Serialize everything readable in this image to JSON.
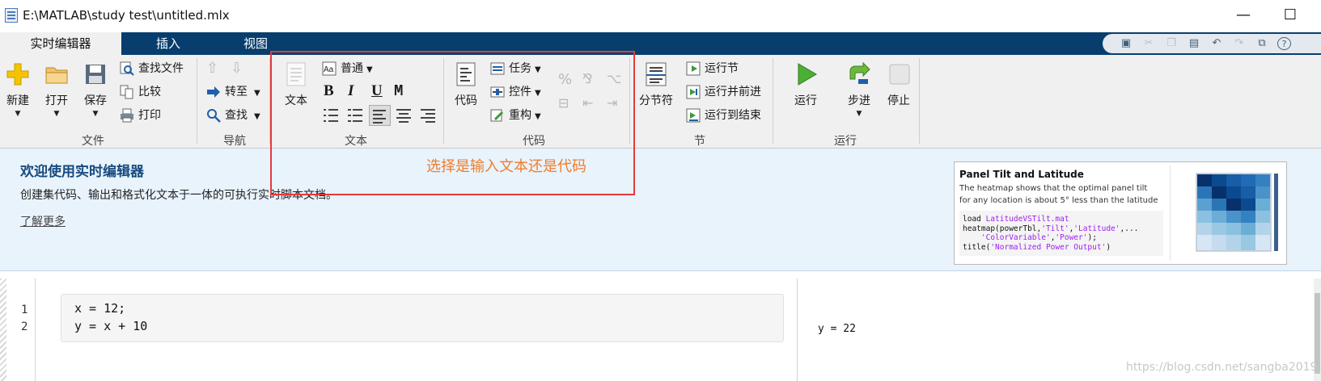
{
  "window": {
    "title": "E:\\MATLAB\\study test\\untitled.mlx",
    "minimize": "—",
    "maximize": "☐"
  },
  "tabs": [
    {
      "label": "实时编辑器",
      "active": true
    },
    {
      "label": "插入",
      "active": false
    },
    {
      "label": "视图",
      "active": false
    }
  ],
  "file_group": {
    "new": "新建",
    "open": "打开",
    "save": "保存",
    "find_files": "查找文件",
    "compare": "比较",
    "print": "打印",
    "label": "文件"
  },
  "nav_group": {
    "goto": "转至",
    "find": "查找",
    "label": "导航"
  },
  "text_group": {
    "text": "文本",
    "style": "普通",
    "bold": "B",
    "italic": "I",
    "underline": "U",
    "mono": "M",
    "label": "文本"
  },
  "code_group": {
    "code": "代码",
    "task": "任务",
    "control": "控件",
    "refactor": "重构",
    "label": "代码"
  },
  "section_group": {
    "break": "分节符",
    "run_section": "运行节",
    "run_advance": "运行并前进",
    "run_to_end": "运行到结束",
    "label": "节"
  },
  "run_group": {
    "run": "运行",
    "step": "步进",
    "stop": "停止",
    "label": "运行"
  },
  "welcome": {
    "title": "欢迎使用实时编辑器",
    "description": "创建集代码、输出和格式化文本于一体的可执行实时脚本文档。",
    "link": "了解更多",
    "annotation": "选择是输入文本还是代码"
  },
  "example_card": {
    "title": "Panel Tilt and Latitude",
    "description": "The heatmap shows that the optimal panel tilt for any location is about 5° less than the latitude",
    "code": {
      "l1_a": "load ",
      "l1_b": "LatitudeVSTilt.mat",
      "l2_a": "heatmap(powerTbl,",
      "l2_b": "'Tilt'",
      "l2_c": ",",
      "l2_d": "'Latitude'",
      "l2_e": ",...",
      "l3_a": "    ",
      "l3_b": "'ColorVariable'",
      "l3_c": ",",
      "l3_d": "'Power'",
      "l3_e": ");",
      "l4_a": "title(",
      "l4_b": "'Normalized Power Output'",
      "l4_c": ")"
    }
  },
  "editor": {
    "lines": [
      {
        "num": "1",
        "code": "x = 12;"
      },
      {
        "num": "2",
        "code": "y = x + 10"
      }
    ],
    "output": "y = 22"
  },
  "watermark": "https://blog.csdn.net/sangba2019",
  "colors": {
    "tabstrip": "#073e6d",
    "ribbon": "#f0f0f0",
    "welcome_bg": "#e9f3fc",
    "welcome_title": "#154a7e",
    "annotation": "#ee7d2d",
    "highlight": "#e33b3b"
  }
}
